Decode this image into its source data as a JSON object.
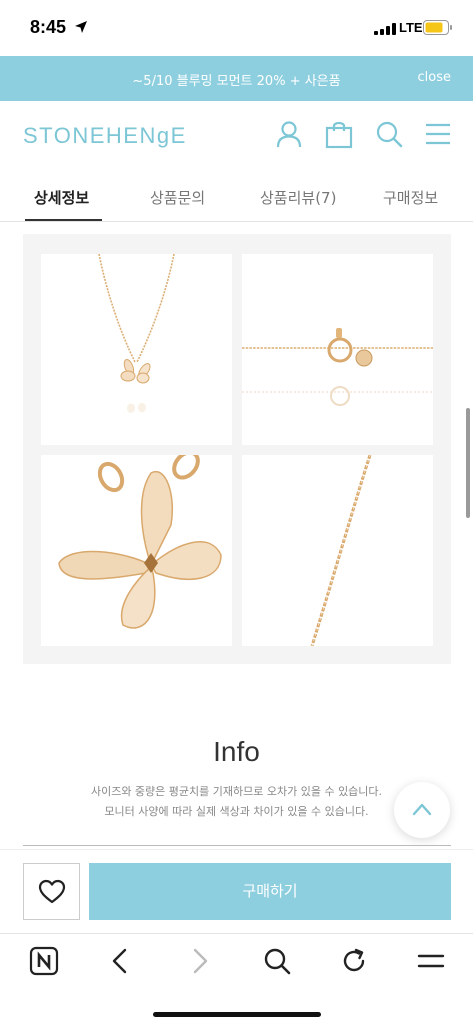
{
  "status": {
    "time": "8:45",
    "network": "LTE"
  },
  "promo": {
    "text": "~5/10 블루밍 모먼트 20% + 사은품",
    "close": "close"
  },
  "header": {
    "logo": "STONEHENgE"
  },
  "tabs": [
    {
      "label": "상세정보",
      "active": true
    },
    {
      "label": "상품문의",
      "active": false
    },
    {
      "label": "상품리뷰(7)",
      "active": false
    },
    {
      "label": "구매정보",
      "active": false
    }
  ],
  "info": {
    "title": "Info",
    "line1": "사이즈와 중량은 평균치를 기재하므로 오차가 있을 수 있습니다.",
    "line2": "모니터 사양에 따라 실제 색상과 차이가 있을 수 있습니다."
  },
  "buy_button": "구매하기",
  "colors": {
    "accent": "#8ecfdf",
    "logo": "#7cc6d6",
    "gold": "#e2b57a"
  },
  "icons": [
    "location-arrow-icon",
    "signal-icon",
    "battery-icon",
    "user-icon",
    "cart-icon",
    "search-icon",
    "menu-icon",
    "chevron-up-icon",
    "heart-icon",
    "naver-home-icon",
    "back-icon",
    "forward-icon",
    "refresh-icon"
  ]
}
